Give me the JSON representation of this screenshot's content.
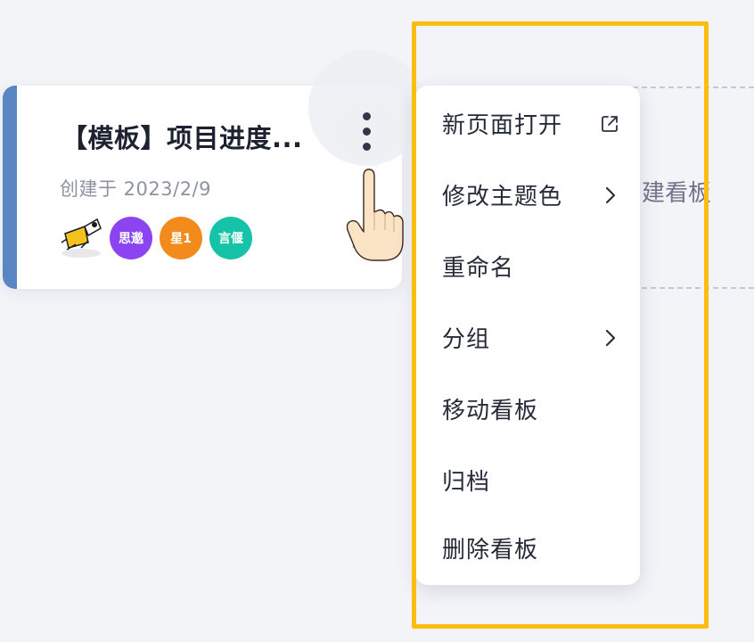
{
  "card": {
    "title": "【模板】项目进度...",
    "created": "创建于 2023/2/9",
    "members": [
      {
        "label": "思邈",
        "color": "#8b44f0"
      },
      {
        "label": "星1",
        "color": "#f28a1c"
      },
      {
        "label": "言偃",
        "color": "#17c3a8"
      }
    ],
    "accent_color": "#5b86c4"
  },
  "new_board": {
    "label": "建看板"
  },
  "menu": {
    "items": [
      {
        "label": "新页面打开",
        "icon": "external-link-icon"
      },
      {
        "label": "修改主题色",
        "icon": "chevron-right-icon"
      },
      {
        "label": "重命名",
        "icon": ""
      },
      {
        "label": "分组",
        "icon": "chevron-right-icon"
      },
      {
        "label": "移动看板",
        "icon": ""
      },
      {
        "label": "归档",
        "icon": ""
      },
      {
        "label": "删除看板",
        "icon": ""
      }
    ]
  },
  "highlight_color": "#fbbd12"
}
